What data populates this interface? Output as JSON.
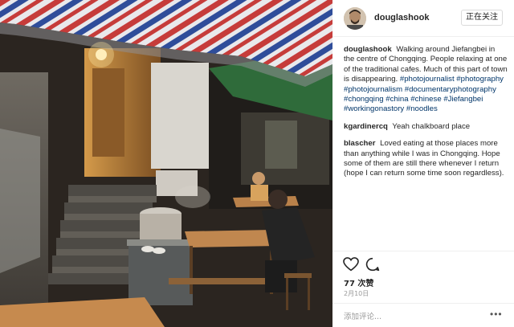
{
  "post": {
    "username": "douglashook",
    "follow_label": "正在关注",
    "likes": "77 次赞",
    "date": "2月10日",
    "add_comment_placeholder": "添加评论...",
    "more_icon": "more-icon",
    "caption": {
      "user": "douglashook",
      "text": "Walking around Jiefangbei in the centre of Chongqing. People relaxing at one of the traditional cafes. Much of this part of town is disappearing.",
      "hashtags": [
        "#photojournalist",
        "#photography",
        "#photojournalism",
        "#documentaryphotography",
        "#chongqing",
        "#china",
        "#chinese",
        "#Jiefangbei",
        "#workingonastory",
        "#noodles"
      ]
    },
    "comments": [
      {
        "user": "kgardinercq",
        "text": "Yeah chalkboard place"
      },
      {
        "user": "blascher",
        "text": "Loved eating at those places more than anything while I was in Chongqing. Hope some of them are still there whenever I return (hope I can return some time soon regardless)."
      }
    ]
  },
  "colors": {
    "link": "#003569",
    "border": "#efefef",
    "muted": "#999999"
  }
}
